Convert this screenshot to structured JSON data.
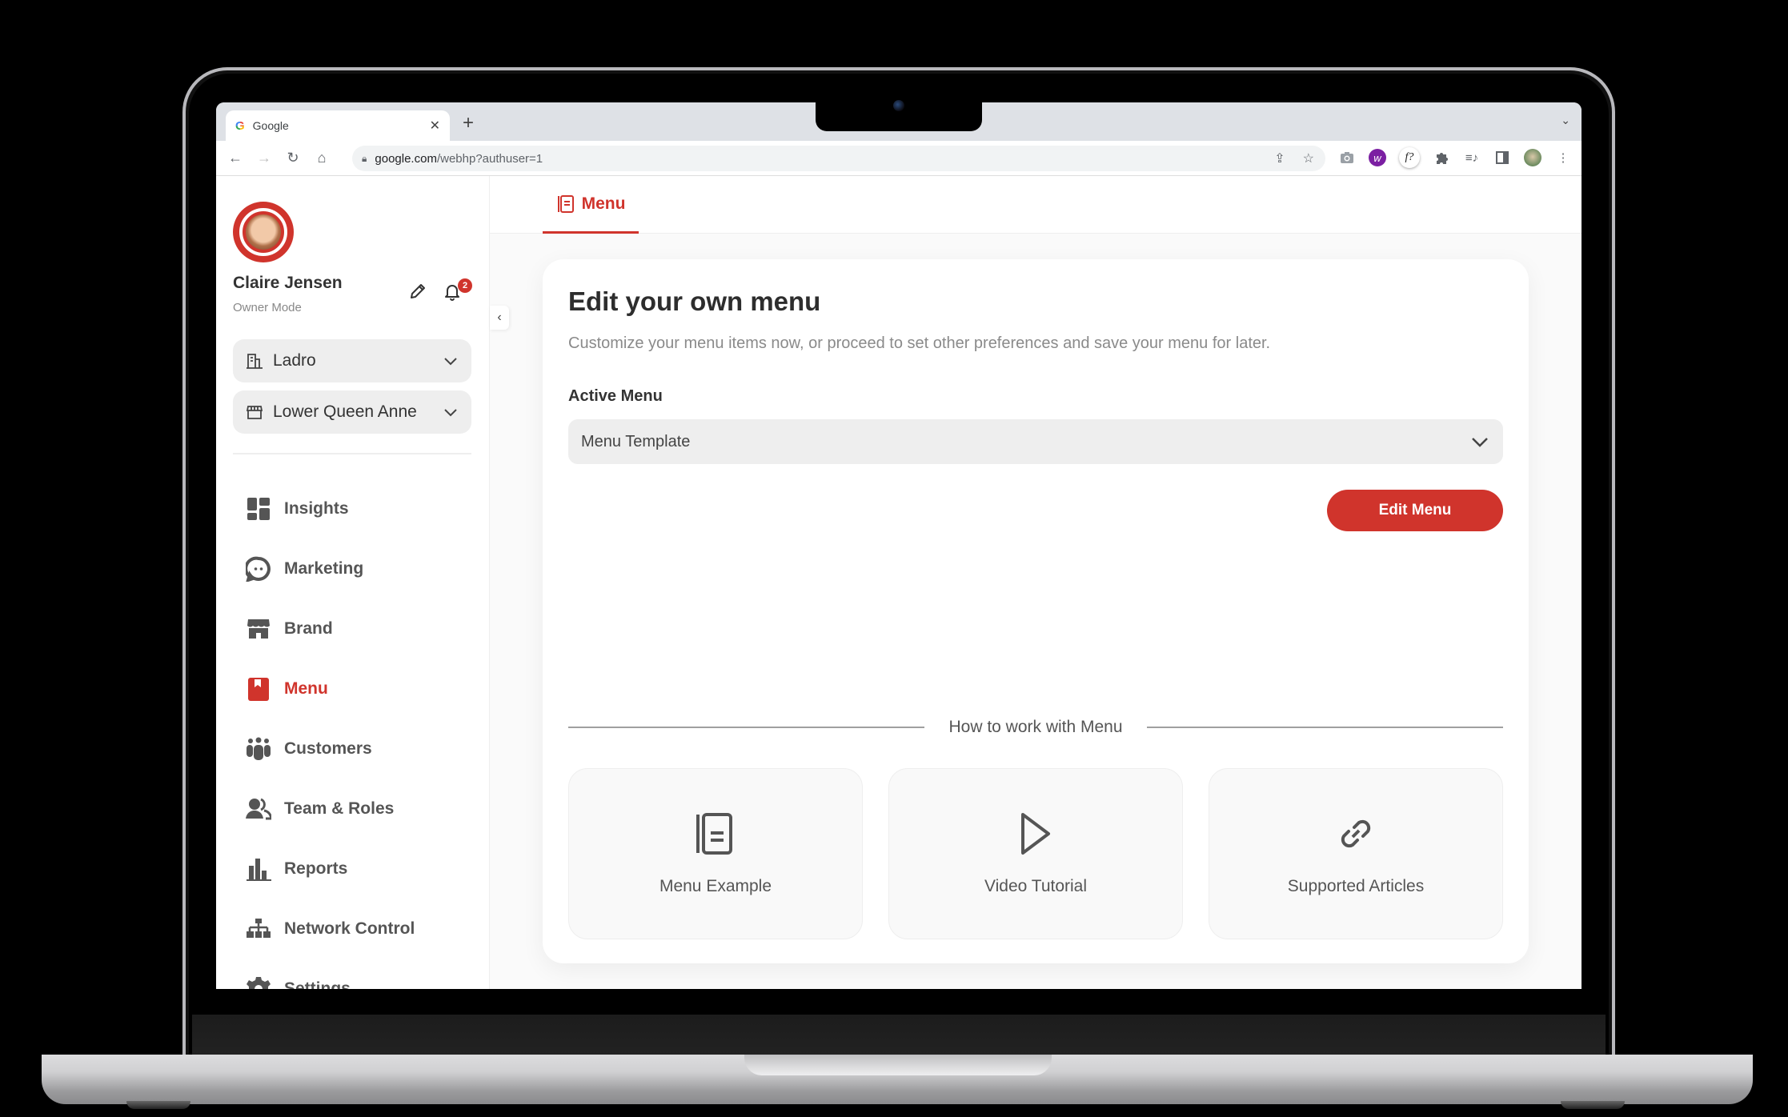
{
  "browser": {
    "tab_title": "Google",
    "new_tab_label": "+",
    "url_host": "google.com",
    "url_path": "/webhp?authuser=1",
    "extensions": [
      "camera-icon",
      "w-extension-icon",
      "f-question-extension-icon",
      "puzzle-icon",
      "media-queue-icon",
      "side-panel-icon",
      "profile-avatar-icon"
    ]
  },
  "sidebar": {
    "user_name": "Claire Jensen",
    "user_role": "Owner Mode",
    "notification_count": "2",
    "business_select": "Ladro",
    "location_select": "Lower Queen Anne",
    "items": [
      {
        "label": "Insights",
        "icon": "insights-grid-icon"
      },
      {
        "label": "Marketing",
        "icon": "marketing-chat-icon"
      },
      {
        "label": "Brand",
        "icon": "brand-store-icon"
      },
      {
        "label": "Menu",
        "icon": "menu-book-icon",
        "active": true
      },
      {
        "label": "Customers",
        "icon": "customers-group-icon"
      },
      {
        "label": "Team & Roles",
        "icon": "team-users-icon"
      },
      {
        "label": "Reports",
        "icon": "reports-bar-icon"
      },
      {
        "label": "Network Control",
        "icon": "network-sitemap-icon"
      },
      {
        "label": "Settings",
        "icon": "settings-gear-icon"
      }
    ]
  },
  "topnav": {
    "active_tab": "Menu"
  },
  "main": {
    "title": "Edit your own menu",
    "subtitle": "Customize your menu items now, or proceed to set other preferences and save your menu for later.",
    "active_menu_label": "Active Menu",
    "active_menu_value": "Menu Template",
    "edit_button": "Edit Menu",
    "howto_title": "How to work with Menu",
    "tiles": [
      {
        "label": "Menu Example",
        "icon": "menu-document-icon"
      },
      {
        "label": "Video Tutorial",
        "icon": "play-icon"
      },
      {
        "label": "Supported Articles",
        "icon": "link-icon"
      }
    ]
  },
  "colors": {
    "accent": "#d0342c",
    "text": "#333333",
    "muted": "#8a8a8a"
  }
}
